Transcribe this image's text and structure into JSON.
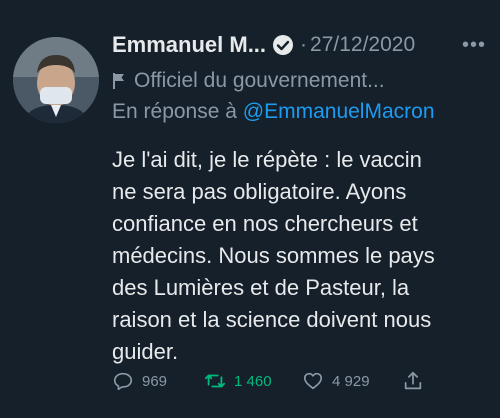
{
  "tweet": {
    "display_name": "Emmanuel M...",
    "separator": "·",
    "date": "27/12/2020",
    "more_label": "•••",
    "account_label": "Officiel du gouvernement...",
    "reply_prefix": "En réponse à",
    "reply_handle": "@EmmanuelMacron",
    "body_lines": [
      "Je l'ai dit, je le répète : le vaccin",
      "ne sera pas obligatoire. Ayons",
      "confiance en nos chercheurs et",
      "médecins. Nous sommes le pays",
      "des Lumières et de Pasteur, la",
      "raison et la science doivent nous",
      "guider."
    ]
  },
  "actions": {
    "reply_count": "969",
    "retweet_count": "1 460",
    "like_count": "4 929"
  },
  "icons": {
    "verified": "verified-badge-icon",
    "flag": "government-flag-icon",
    "reply": "reply-icon",
    "retweet": "retweet-icon",
    "like": "heart-icon",
    "share": "share-icon"
  },
  "colors": {
    "background": "#15202b",
    "accent": "#1d9bf0",
    "retweet_active": "#00ba7c",
    "muted": "#8b98a5"
  }
}
